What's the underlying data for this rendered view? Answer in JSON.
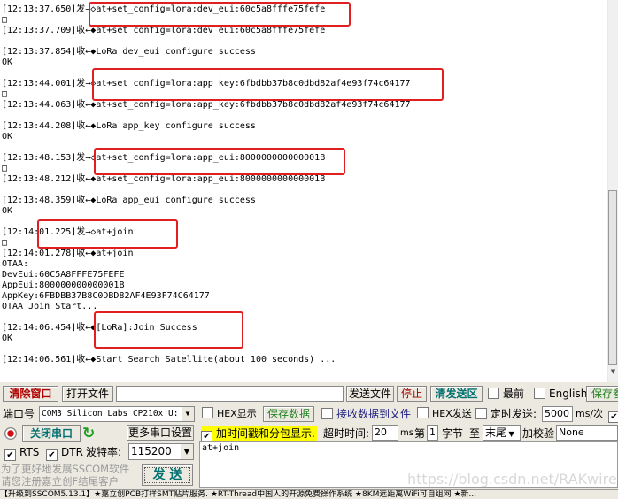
{
  "receive": {
    "lines": [
      "[12:13:37.650]发→◇at+set_config=lora:dev_eui:60c5a8fffe75fefe",
      "□",
      "[12:13:37.709]收←◆at+set_config=lora:dev_eui:60c5a8fffe75fefe",
      "",
      "[12:13:37.854]收←◆LoRa dev_eui configure success",
      "OK",
      "",
      "[12:13:44.001]发→◇at+set_config=lora:app_key:6fbdbb37b8c0dbd82af4e93f74c64177",
      "□",
      "[12:13:44.063]收←◆at+set_config=lora:app_key:6fbdbb37b8c0dbd82af4e93f74c64177",
      "",
      "[12:13:44.208]收←◆LoRa app_key configure success",
      "OK",
      "",
      "[12:13:48.153]发→◇at+set_config=lora:app_eui:800000000000001B",
      "□",
      "[12:13:48.212]收←◆at+set_config=lora:app_eui:800000000000001B",
      "",
      "[12:13:48.359]收←◆LoRa app_eui configure success",
      "OK",
      "",
      "[12:14:01.225]发→◇at+join",
      "□",
      "[12:14:01.278]收←◆at+join",
      "OTAA:",
      "DevEui:60C5A8FFFE75FEFE",
      "AppEui:800000000000001B",
      "AppKey:6FBDBB37B8C0DBD82AF4E93F74C64177",
      "OTAA Join Start...",
      "",
      "[12:14:06.454]收←◆[LoRa]:Join Success",
      "OK",
      "",
      "[12:14:06.561]收←◆Start Search Satellite(about 100 seconds) ..."
    ],
    "highlight_color": "#e02020"
  },
  "toolbar": {
    "clear": "清除窗口",
    "open_file": "打开文件",
    "file_path": "",
    "send_file": "发送文件",
    "stop": "停止",
    "clear_send": "清发送区",
    "topmost": "最前",
    "english": "English",
    "save_params": "保存参数"
  },
  "port": {
    "label": "端口号",
    "value": "COM3 Silicon Labs CP210x U:",
    "close": "关闭串口",
    "more": "更多串口设置",
    "rts": "RTS",
    "dtr": "DTR",
    "baud_label": "波特率:",
    "baud": "115200"
  },
  "options": {
    "hex_show": "HEX显示",
    "save_data": "保存数据",
    "recv_to_file": "接收数据到文件",
    "hex_send": "HEX发送",
    "timed_send": "定时发送:",
    "interval": "5000",
    "interval_unit": "ms/次",
    "timestamp": "加时间戳和分包显示.",
    "timeout_label": "超时时间:",
    "timeout": "20",
    "timeout_unit": "ms",
    "nth": "第",
    "byte_index": "1",
    "byte_label": "字节",
    "to": "至",
    "end": "末尾",
    "checksum_label": "加校验",
    "checksum": "None"
  },
  "send": {
    "text": "at+join",
    "button": "发 送"
  },
  "promo": {
    "line1": "为了更好地发展SSCOM软件",
    "line2": "请您注册嘉立创F结尾客户"
  },
  "status": "【升级到SSCOM5.13.1】★嘉立创PCB打样SMT贴片服务. ★RT-Thread中国人的开源免费操作系统 ★8KM远距离WiFi可自组网 ★新...",
  "watermark": "https://blog.csdn.net/RAKwireless"
}
